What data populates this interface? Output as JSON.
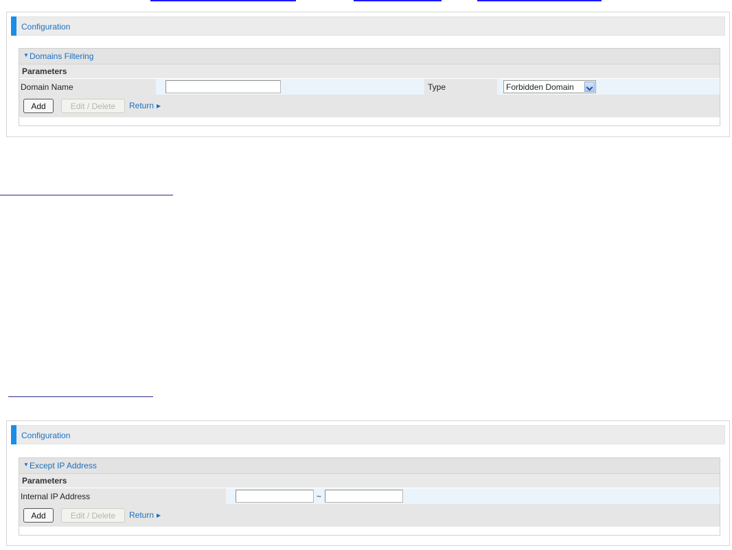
{
  "panel1": {
    "config_label": "Configuration",
    "section_title": "Domains Filtering",
    "parameters_label": "Parameters",
    "domain_name_label": "Domain Name",
    "domain_name_value": "",
    "type_label": "Type",
    "type_selected": "Forbidden Domain",
    "add_label": "Add",
    "edit_delete_label": "Edit / Delete",
    "return_label": "Return"
  },
  "panel2": {
    "config_label": "Configuration",
    "section_title": "Except IP Address",
    "parameters_label": "Parameters",
    "internal_ip_label": "Internal IP Address",
    "ip_start_value": "",
    "range_separator": "~",
    "ip_end_value": "",
    "add_label": "Add",
    "edit_delete_label": "Edit / Delete",
    "return_label": "Return"
  },
  "colors": {
    "accent": "#1a8ee6",
    "link": "#1a70c0",
    "field_row_bg": "#ecf4fb"
  }
}
